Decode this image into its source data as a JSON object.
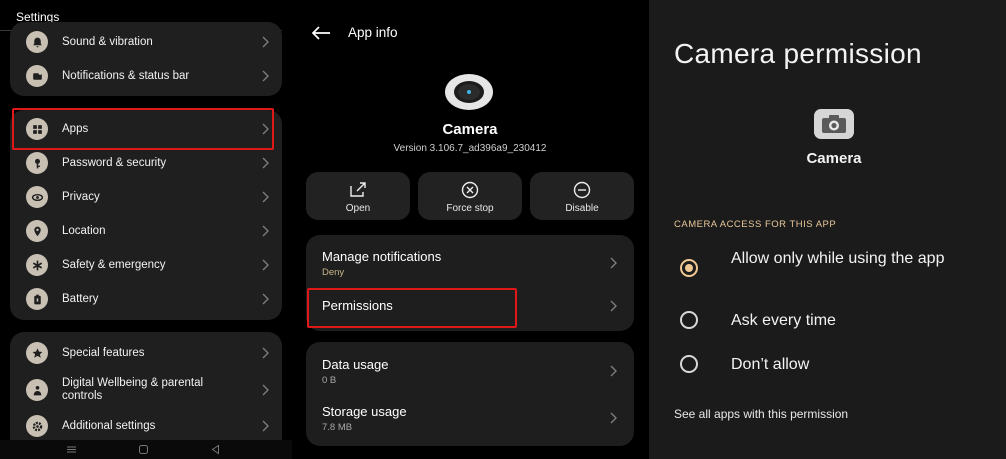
{
  "settings": {
    "title": "Settings",
    "group1": [
      {
        "label": "Sound & vibration",
        "icon": "bell-icon"
      },
      {
        "label": "Notifications & status bar",
        "icon": "notification-icon"
      }
    ],
    "group2": [
      {
        "label": "Apps",
        "icon": "apps-grid-icon"
      },
      {
        "label": "Password & security",
        "icon": "key-icon"
      },
      {
        "label": "Privacy",
        "icon": "privacy-icon"
      },
      {
        "label": "Location",
        "icon": "location-pin-icon"
      },
      {
        "label": "Safety & emergency",
        "icon": "asterisk-icon"
      },
      {
        "label": "Battery",
        "icon": "battery-icon"
      }
    ],
    "group3": [
      {
        "label": "Special features",
        "icon": "star-icon"
      },
      {
        "label": "Digital Wellbeing & parental controls",
        "icon": "wellbeing-icon"
      },
      {
        "label": "Additional settings",
        "icon": "gear-icon"
      }
    ],
    "highlight_color": "#e01818"
  },
  "app_info": {
    "title": "App info",
    "app_name": "Camera",
    "version": "Version 3.106.7_ad396a9_230412",
    "actions": [
      {
        "label": "Open",
        "icon": "open-external-icon"
      },
      {
        "label": "Force stop",
        "icon": "force-stop-icon"
      },
      {
        "label": "Disable",
        "icon": "disable-icon"
      }
    ],
    "manage_notifications": {
      "title": "Manage notifications",
      "sub": "Deny"
    },
    "permissions": {
      "title": "Permissions"
    },
    "data_usage": {
      "title": "Data usage",
      "sub": "0 B"
    },
    "storage_usage": {
      "title": "Storage usage",
      "sub": "7.8 MB"
    }
  },
  "camera_permission": {
    "title": "Camera permission",
    "app_name": "Camera",
    "section": "CAMERA ACCESS FOR THIS APP",
    "options": [
      {
        "label": "Allow only while using the app",
        "selected": true
      },
      {
        "label": "Ask every time",
        "selected": false
      },
      {
        "label": "Don’t allow",
        "selected": false
      }
    ],
    "link": "See all apps with this permission",
    "accent": "#f0c894"
  }
}
